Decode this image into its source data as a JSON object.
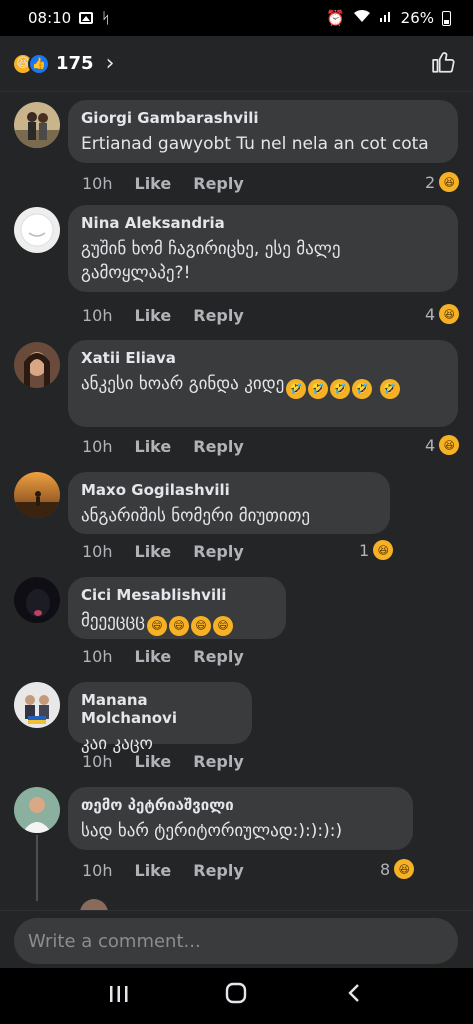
{
  "status": {
    "time": "08:10",
    "battery": "26%"
  },
  "header": {
    "reaction_count": "175",
    "chevron": "›"
  },
  "comments": [
    {
      "author": "Giorgi Gambarashvili",
      "text": "Ertianad gawyobt Tu nel nela an cot cota",
      "time": "10h",
      "like": "Like",
      "reply": "Reply",
      "reactions": "2"
    },
    {
      "author": "Nina Aleksandria",
      "text": "გუშინ ხომ ჩაგირიცხე, ესე მალე გამოყლაპე?!",
      "time": "10h",
      "like": "Like",
      "reply": "Reply",
      "reactions": "4"
    },
    {
      "author": "Xatii Eliava",
      "text": "ანკესი ხოარ გინდა კიდე",
      "time": "10h",
      "like": "Like",
      "reply": "Reply",
      "reactions": "4"
    },
    {
      "author": "Maxo Gogilashvili",
      "text": "ანგარიშის ნომერი მიუთითე",
      "time": "10h",
      "like": "Like",
      "reply": "Reply",
      "reactions": "1"
    },
    {
      "author": "Cici Mesablishvili",
      "text": "მეეეცცც",
      "time": "10h",
      "like": "Like",
      "reply": "Reply",
      "reactions": ""
    },
    {
      "author": "Manana Molchanovi",
      "text": "კაი კაცო",
      "time": "10h",
      "like": "Like",
      "reply": "Reply",
      "reactions": ""
    },
    {
      "author": "თემო პეტრიაშვილი",
      "text": "სად ხარ ტერიტორიულად:):):):)",
      "time": "10h",
      "like": "Like",
      "reply": "Reply",
      "reactions": "8"
    }
  ],
  "composer": {
    "placeholder": "Write a comment..."
  }
}
